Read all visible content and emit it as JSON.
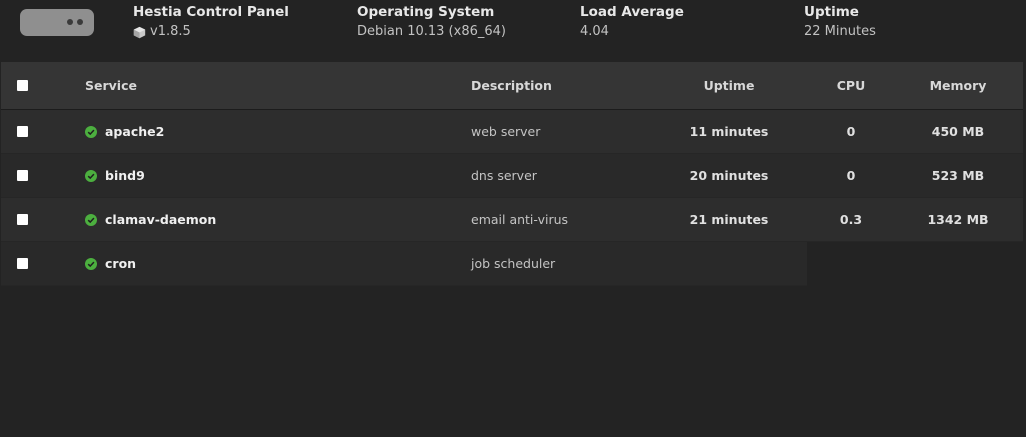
{
  "header": {
    "panel": {
      "title": "Hestia Control Panel",
      "value": "v1.8.5"
    },
    "os": {
      "title": "Operating System",
      "value": "Debian 10.13 (x86_64)"
    },
    "load": {
      "title": "Load Average",
      "value": "4.04"
    },
    "uptime": {
      "title": "Uptime",
      "value": "22 Minutes"
    }
  },
  "table": {
    "columns": {
      "service": "Service",
      "description": "Description",
      "uptime": "Uptime",
      "cpu": "CPU",
      "memory": "Memory"
    },
    "rows": [
      {
        "service": "apache2",
        "description": "web server",
        "uptime": "11 minutes",
        "cpu": "0",
        "memory": "450 MB",
        "status": "running"
      },
      {
        "service": "bind9",
        "description": "dns server",
        "uptime": "20 minutes",
        "cpu": "0",
        "memory": "523 MB",
        "status": "running"
      },
      {
        "service": "clamav-daemon",
        "description": "email anti-virus",
        "uptime": "21 minutes",
        "cpu": "0.3",
        "memory": "1342 MB",
        "status": "running"
      },
      {
        "service": "cron",
        "description": "job scheduler",
        "uptime": "",
        "cpu": "",
        "memory": "",
        "status": "running"
      }
    ]
  },
  "colors": {
    "status_ok": "#4caf3f",
    "background": "#232323",
    "header_row": "#353535"
  },
  "icons": {
    "server": "server-icon",
    "version": "cube-icon",
    "status": "check-circle-icon"
  }
}
